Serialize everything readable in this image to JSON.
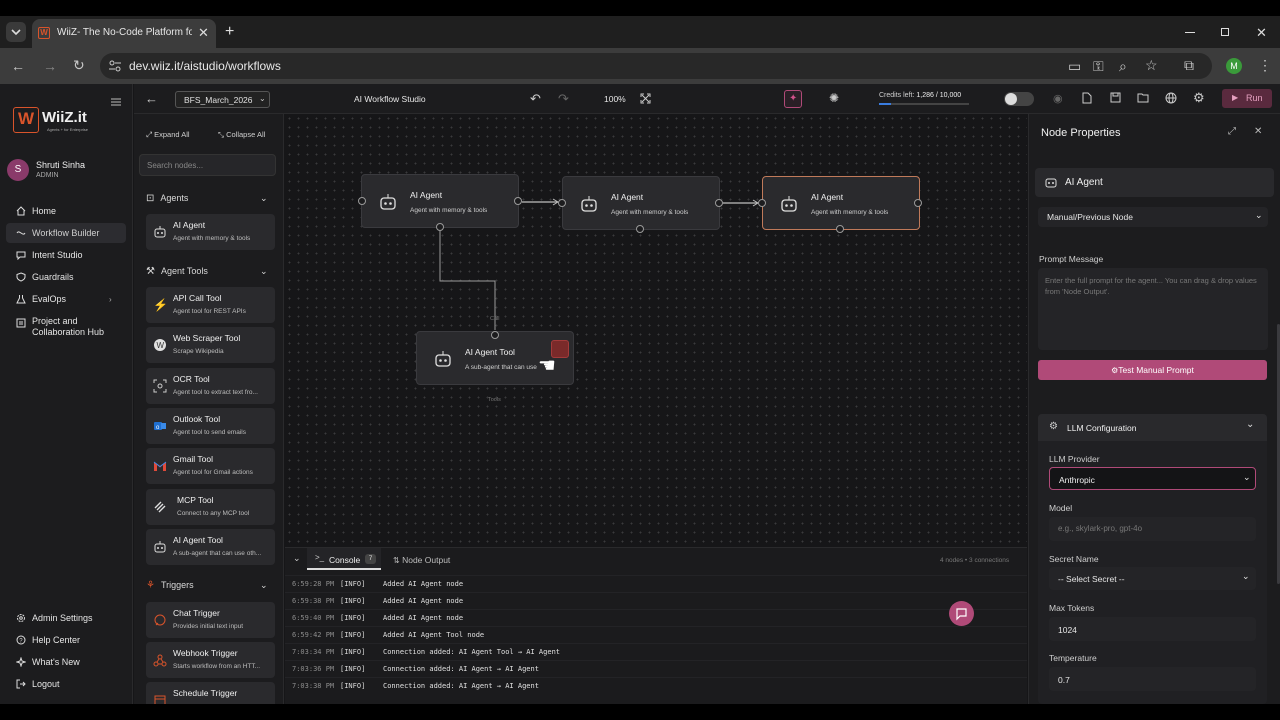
{
  "browser": {
    "tab_title": "WiiZ- The No-Code Platform fo",
    "url": "dev.wiiz.it/aistudio/workflows",
    "profile_initial": "M"
  },
  "brand": {
    "name": "WiiZ.it",
    "tagline": "Agents + for Enterprise"
  },
  "user": {
    "initial": "S",
    "name": "Shruti Sinha",
    "role": "ADMIN"
  },
  "nav": {
    "home": "Home",
    "workflow_builder": "Workflow Builder",
    "intent_studio": "Intent Studio",
    "guardrails": "Guardrails",
    "evalops": "EvalOps",
    "project_hub_line1": "Project and",
    "project_hub_line2": "Collaboration Hub",
    "admin_settings": "Admin Settings",
    "help_center": "Help Center",
    "whats_new": "What's New",
    "logout": "Logout"
  },
  "palette": {
    "expand_all": "Expand All",
    "collapse_all": "Collapse All",
    "search_placeholder": "Search nodes...",
    "section_agents": "Agents",
    "section_tools": "Agent Tools",
    "section_triggers": "Triggers",
    "cards": [
      {
        "title": "AI Agent",
        "sub": "Agent with memory & tools"
      },
      {
        "title": "API Call Tool",
        "sub": "Agent tool for REST APIs"
      },
      {
        "title": "Web Scraper Tool",
        "sub": "Scrape Wikipedia"
      },
      {
        "title": "OCR Tool",
        "sub": "Agent tool to extract text fro..."
      },
      {
        "title": "Outlook Tool",
        "sub": "Agent tool to send emails"
      },
      {
        "title": "Gmail Tool",
        "sub": "Agent tool for Gmail actions"
      },
      {
        "title": "MCP Tool",
        "sub": "Connect to any MCP tool"
      },
      {
        "title": "AI Agent Tool",
        "sub": "A sub-agent that can use oth..."
      },
      {
        "title": "Chat Trigger",
        "sub": "Provides initial text input"
      },
      {
        "title": "Webhook Trigger",
        "sub": "Starts workflow from an HTT..."
      },
      {
        "title": "Schedule Trigger",
        "sub": ""
      }
    ]
  },
  "toolbar": {
    "workflow_select": "BFS_March_2026",
    "studio_title": "AI Workflow Studio",
    "zoom": "100%",
    "credits_label": "Credits left:",
    "credits_value": "1,286 / 10,000",
    "credits_fraction": 0.1286,
    "run_label": "Run"
  },
  "canvas": {
    "nodes": [
      {
        "title": "AI Agent",
        "sub": "Agent with memory & tools"
      },
      {
        "title": "AI Agent",
        "sub": "Agent with memory & tools"
      },
      {
        "title": "AI Agent",
        "sub": "Agent with memory & tools"
      },
      {
        "title": "AI Agent Tool",
        "sub": "A sub-agent that can use"
      }
    ],
    "tool_top_label": "Call",
    "tool_bottom_label": "Tools"
  },
  "console": {
    "tab_console": "Console",
    "console_count": "7",
    "tab_output": "Node Output",
    "stats": "4 nodes • 3 connections",
    "logs": [
      {
        "time": "6:59:28 PM",
        "level": "[INFO]",
        "msg": "Added AI Agent node"
      },
      {
        "time": "6:59:38 PM",
        "level": "[INFO]",
        "msg": "Added AI Agent node"
      },
      {
        "time": "6:59:40 PM",
        "level": "[INFO]",
        "msg": "Added AI Agent node"
      },
      {
        "time": "6:59:42 PM",
        "level": "[INFO]",
        "msg": "Added AI Agent Tool node"
      },
      {
        "time": "7:03:34 PM",
        "level": "[INFO]",
        "msg": "Connection added: AI Agent Tool → AI Agent"
      },
      {
        "time": "7:03:36 PM",
        "level": "[INFO]",
        "msg": "Connection added: AI Agent → AI Agent"
      },
      {
        "time": "7:03:38 PM",
        "level": "[INFO]",
        "msg": "Connection added: AI Agent → AI Agent"
      }
    ]
  },
  "props": {
    "title": "Node Properties",
    "node_name": "AI Agent",
    "input_mode": "Manual/Previous Node",
    "prompt_label": "Prompt Message",
    "prompt_placeholder": "Enter the full prompt for the agent... You can drag & drop values from 'Node Output'.",
    "test_button": "Test Manual Prompt",
    "llm_section": "LLM Configuration",
    "provider_label": "LLM Provider",
    "provider_value": "Anthropic",
    "model_label": "Model",
    "model_placeholder": "e.g., skylark-pro, gpt-4o",
    "secret_label": "Secret Name",
    "secret_value": "-- Select Secret --",
    "max_tokens_label": "Max Tokens",
    "max_tokens_value": "1024",
    "temperature_label": "Temperature",
    "temperature_value": "0.7"
  },
  "colors": {
    "accent": "#b04a78",
    "selected_border": "#c07a5a",
    "avatar": "#8a3a6a",
    "profile": "#3a9a3a"
  }
}
